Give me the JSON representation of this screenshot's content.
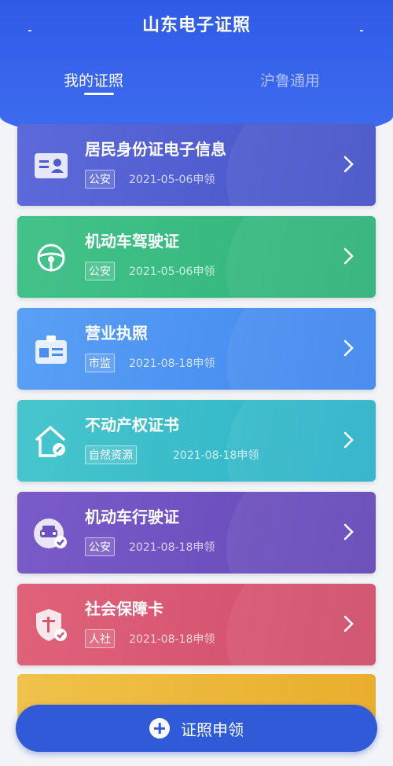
{
  "app": {
    "title": "山东电子证照"
  },
  "tabs": [
    {
      "label": "我的证照",
      "active": true
    },
    {
      "label": "沪鲁通用",
      "active": false
    }
  ],
  "cards": [
    {
      "name": "居民身份证电子信息",
      "authority": "公安",
      "date": "2021-05-06申领",
      "icon": "id-card-icon",
      "color_from": "#5d6ad9",
      "color_to": "#4553c7"
    },
    {
      "name": "机动车驾驶证",
      "authority": "公安",
      "date": "2021-05-06申领",
      "icon": "steering-wheel-icon",
      "color_from": "#43c38a",
      "color_to": "#2fb27a"
    },
    {
      "name": "营业执照",
      "authority": "市监",
      "date": "2021-08-18申领",
      "icon": "business-license-icon",
      "color_from": "#5aa0f5",
      "color_to": "#3f86ee"
    },
    {
      "name": "不动产权证书",
      "authority": "自然资源",
      "date": "2021-08-18申领",
      "icon": "house-key-icon",
      "color_from": "#47c6cc",
      "color_to": "#2cb2c8"
    },
    {
      "name": "机动车行驶证",
      "authority": "公安",
      "date": "2021-08-18申领",
      "icon": "car-check-icon",
      "color_from": "#7a5bc8",
      "color_to": "#6448b8"
    },
    {
      "name": "社会保障卡",
      "authority": "人社",
      "date": "2021-08-18申领",
      "icon": "social-security-shield-icon",
      "color_from": "#e0627a",
      "color_to": "#cf4d6b"
    }
  ],
  "bottom_button": {
    "label": "证照申领",
    "icon": "plus-icon"
  }
}
